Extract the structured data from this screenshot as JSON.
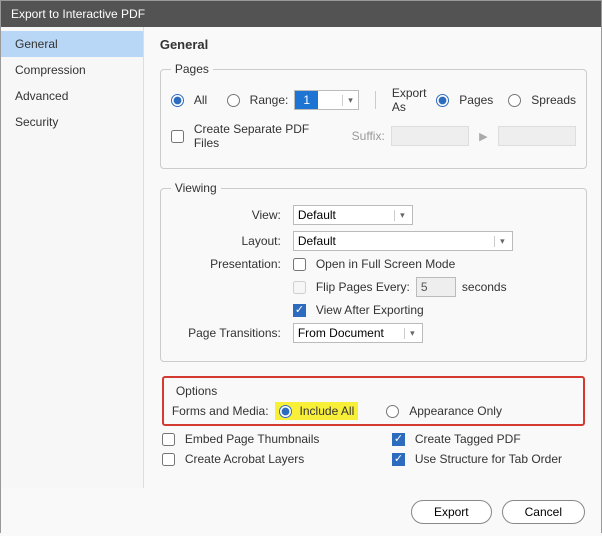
{
  "title": "Export to Interactive PDF",
  "sidebar": {
    "items": [
      {
        "label": "General"
      },
      {
        "label": "Compression"
      },
      {
        "label": "Advanced"
      },
      {
        "label": "Security"
      }
    ]
  },
  "panel_title": "General",
  "pages": {
    "legend": "Pages",
    "all": "All",
    "range": "Range:",
    "range_value": "1",
    "export_as": "Export As",
    "pages_opt": "Pages",
    "spreads_opt": "Spreads",
    "create_separate": "Create Separate PDF Files",
    "suffix": "Suffix:"
  },
  "viewing": {
    "legend": "Viewing",
    "view": "View:",
    "view_value": "Default",
    "layout": "Layout:",
    "layout_value": "Default",
    "presentation": "Presentation:",
    "open_full": "Open in Full Screen Mode",
    "flip_pages": "Flip Pages Every:",
    "flip_value": "5",
    "seconds": "seconds",
    "view_after": "View After Exporting",
    "transitions": "Page Transitions:",
    "transitions_value": "From Document"
  },
  "options": {
    "legend": "Options",
    "forms_media": "Forms and Media:",
    "include_all": "Include All",
    "appearance_only": "Appearance Only",
    "embed_thumbs": "Embed Page Thumbnails",
    "tagged_pdf": "Create Tagged PDF",
    "acrobat_layers": "Create Acrobat Layers",
    "tab_order": "Use Structure for Tab Order"
  },
  "footer": {
    "export": "Export",
    "cancel": "Cancel"
  }
}
